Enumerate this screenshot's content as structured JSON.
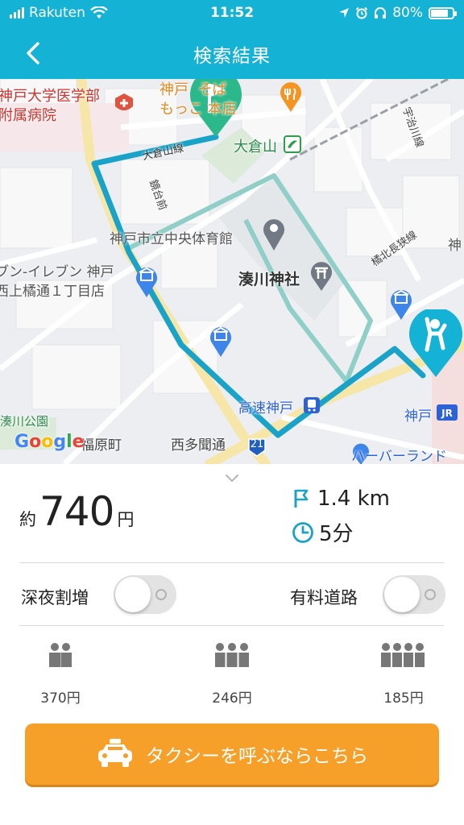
{
  "status_bar": {
    "carrier": "Rakuten",
    "time": "11:52",
    "battery": "80%"
  },
  "nav": {
    "title": "検索結果"
  },
  "map": {
    "labels": {
      "hospital": "神戸大学医学部\n附属病院",
      "restaurant": "神戸  そば\nもっこ 本店",
      "station_okurayama": "大倉山",
      "road_okurayama": "大倉山線",
      "kadai": "鏡台前",
      "gymnasium": "神戸市立中央体育館",
      "seven_eleven": "ブン-イレブン 神戸\n西上橘通１丁目店",
      "minatogawa": "湊川神社",
      "kosoku_kobe": "高速神戸",
      "kobe": "神戸",
      "fukuhara": "福原町",
      "nishitamon": "西多聞通",
      "route21": "21",
      "park": "湊川公園",
      "harborland": "ハーバーランド",
      "ujikawa": "宇治川線",
      "tachibana": "橘北長狭線",
      "kobe_edge": "神"
    },
    "google": "Google"
  },
  "result": {
    "fare_prefix": "約",
    "fare": "740",
    "fare_unit": "円",
    "distance": "1.4 km",
    "duration": "5分"
  },
  "options": {
    "late_night": {
      "label": "深夜割増",
      "on": false
    },
    "toll_road": {
      "label": "有料道路",
      "on": false
    }
  },
  "split": [
    {
      "people": 2,
      "price": "370円"
    },
    {
      "people": 3,
      "price": "246円"
    },
    {
      "people": 4,
      "price": "185円"
    }
  ],
  "cta": {
    "label": "タクシーを呼ぶならこちら"
  },
  "colors": {
    "accent": "#14b2d4",
    "route": "#1aa3c8",
    "route_alt": "#8fcfc7",
    "cta": "#f6a02a",
    "goal_pin": "#2bb88a",
    "start_pin": "#14b2d4"
  }
}
